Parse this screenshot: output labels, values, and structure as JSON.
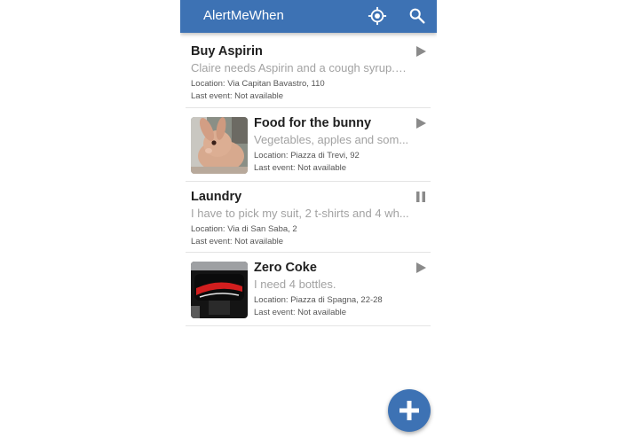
{
  "app": {
    "title": "AlertMeWhen"
  },
  "colors": {
    "primary": "#3d72b4",
    "title_text": "#1f1f1f",
    "secondary_text": "#a2a2a2"
  },
  "toolbar": {
    "icons": [
      "my-location-icon",
      "search-icon"
    ]
  },
  "alerts": [
    {
      "title": "Buy Aspirin",
      "description": "Claire needs Aspirin and a cough syrup. I...",
      "location": "Location: Via Capitan Bavastro, 110",
      "last_event": "Last event: Not available",
      "state_icon": "play-icon"
    },
    {
      "title": "Food for the bunny",
      "description": "Vegetables, apples and som...",
      "location": "Location: Piazza di Trevi, 92",
      "last_event": "Last event: Not available",
      "state_icon": "play-icon",
      "image": "rabbit-photo"
    },
    {
      "title": "Laundry",
      "description": "I have to pick my suit, 2 t-shirts and 4 wh...",
      "location": "Location: Via di San Saba, 2",
      "last_event": "Last event: Not available",
      "state_icon": "pause-icon"
    },
    {
      "title": "Zero Coke",
      "description": "I need 4 bottles.",
      "location": "Location: Piazza di Spagna, 22-28",
      "last_event": "Last event: Not available",
      "state_icon": "play-icon",
      "image": "coke-zero-photo"
    }
  ],
  "fab": {
    "icon": "add-icon"
  }
}
